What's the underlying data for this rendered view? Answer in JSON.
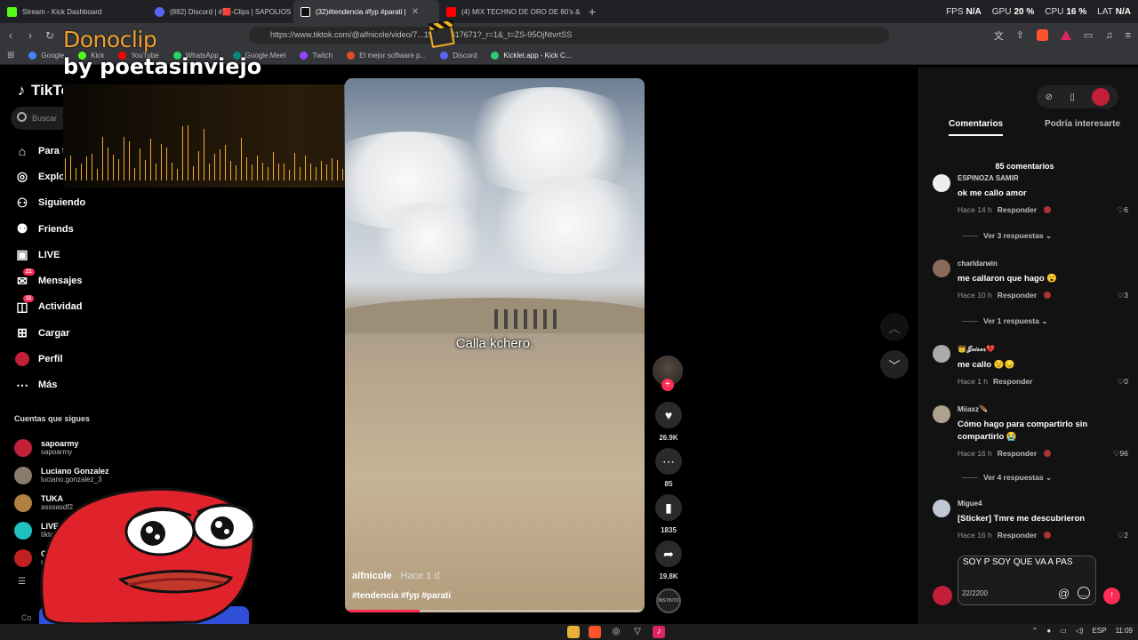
{
  "browser": {
    "tabs": [
      {
        "label": "Stream - Kick Dashboard",
        "color": "#53fc18",
        "active": false
      },
      {
        "label": "(882) Discord | #🟥-Clips | SAPOLIOS",
        "color": "#5865f2",
        "active": false
      },
      {
        "label": "(32)#tendencia #fyp #parati |",
        "color": "#ffffff",
        "active": true
      },
      {
        "label": "(4) MIX TECHNO DE ORO DE 80's &",
        "color": "#ff0000",
        "active": false
      }
    ],
    "new_tab": "+",
    "metrics": [
      {
        "label": "FPS",
        "value": "N/A"
      },
      {
        "label": "GPU",
        "value": "20 %"
      },
      {
        "label": "CPU",
        "value": "16 %"
      },
      {
        "label": "LAT",
        "value": "N/A"
      }
    ],
    "url": "https://www.tiktok.com/@alfnicole/video/7...197433617671?_r=1&_t=ZS-95OjNtvrtSS",
    "bookmarks": [
      "Google",
      "Kick",
      "YouTube",
      "WhatsApp",
      "Google Meet",
      "Twitch",
      "El mejor software p...",
      "Discord",
      "Kicklet.app - Kick C..."
    ]
  },
  "overlay": {
    "title": "Donoclip",
    "subtitle": "by poetasinviejo"
  },
  "sidebar": {
    "logo": "TikTok",
    "search_placeholder": "Buscar",
    "items": [
      {
        "label": "Para ti",
        "icon": "home-icon"
      },
      {
        "label": "Explorar",
        "icon": "compass-icon"
      },
      {
        "label": "Siguiendo",
        "icon": "following-icon"
      },
      {
        "label": "Friends",
        "icon": "friends-icon"
      },
      {
        "label": "LIVE",
        "icon": "live-icon"
      },
      {
        "label": "Mensajes",
        "icon": "messages-icon",
        "badge": "21"
      },
      {
        "label": "Actividad",
        "icon": "activity-icon",
        "badge": "11"
      },
      {
        "label": "Cargar",
        "icon": "upload-icon"
      },
      {
        "label": "Perfil",
        "icon": "profile-icon"
      },
      {
        "label": "Más",
        "icon": "more-icon"
      }
    ],
    "following_heading": "Cuentas que sigues",
    "following": [
      {
        "name": "sapoarmy",
        "user": "sapoarmy",
        "color": "#c21f3a"
      },
      {
        "name": "Luciano Gonzalez",
        "user": "luciano.gonzalez_3",
        "color": "#8a7a6a"
      },
      {
        "name": "TUKA",
        "user": "asssasdf2",
        "color": "#b08040"
      },
      {
        "name": "LIVE Fe",
        "user": "tiktok",
        "color": "#20c0c0"
      },
      {
        "name": "C",
        "user": "r",
        "color": "#c02020"
      }
    ],
    "footer": "Co"
  },
  "video": {
    "caption": "Calla kchero.",
    "author": "alfnicole",
    "posted": "· Hace 1 d",
    "tags": "#tendencia #fyp #parati",
    "progress": 0.25
  },
  "actions": {
    "likes": "26.9K",
    "comments": "85",
    "saves": "1835",
    "shares": "19.8K",
    "disc_label": "INSTINTO"
  },
  "comments_panel": {
    "tabs": [
      "Comentarios",
      "Podría interesarte"
    ],
    "count_label": "85 comentarios",
    "comments": [
      {
        "user": "ESPINOZA SAMIR",
        "text": "ok me callo amor",
        "time": "Hace 14 h",
        "reply": "Responder",
        "likes": "6",
        "replies": "Ver 3 respuestas",
        "color": "#eeeeee"
      },
      {
        "user": "charldarwin",
        "text": "me callaron que hago 😮",
        "time": "Hace 10 h",
        "reply": "Responder",
        "likes": "3",
        "replies": "Ver 1 respuesta",
        "color": "#8a6a5a"
      },
      {
        "user": "👑𝓙𝓮𝓲𝓼𝓮𝓻💔",
        "text": "me callo 😟😞",
        "time": "Hace 1 h",
        "reply": "Responder",
        "likes": "0",
        "replies": "",
        "color": "#aaaaaa"
      },
      {
        "user": "Miiaxz🪶",
        "text": "Cómo hago para compartirlo sin compartirlo 😭",
        "time": "Hace 16 h",
        "reply": "Responder",
        "likes": "96",
        "replies": "Ver 4 respuestas",
        "color": "#b0a090"
      },
      {
        "user": "Migue4",
        "text": "[Sticker] Tmre me descubrieron",
        "time": "Hace 16 h",
        "reply": "Responder",
        "likes": "2",
        "replies": "",
        "color": "#c0c8d8"
      }
    ],
    "input_value": "SOY P SOY QUE VA A PAS",
    "char_count": "22/2200"
  },
  "taskbar": {
    "lang": "ESP",
    "time": "11:09"
  }
}
